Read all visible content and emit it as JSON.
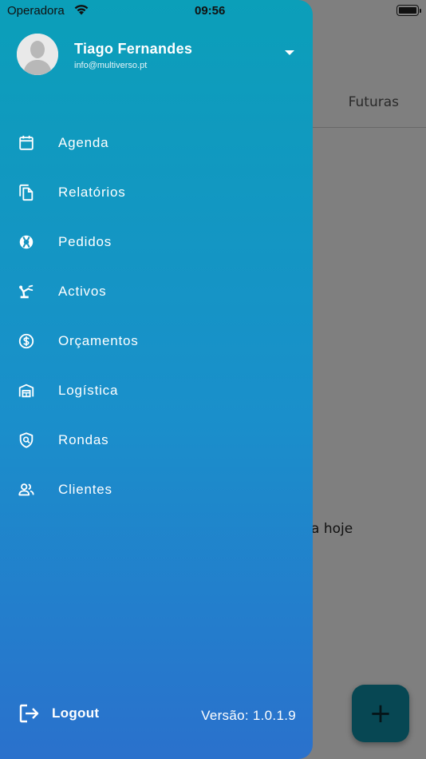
{
  "status_bar": {
    "carrier": "Operadora",
    "time": "09:56"
  },
  "background": {
    "tab_future": "Futuras",
    "empty_text": "a hoje",
    "fab_label": "+"
  },
  "drawer": {
    "user": {
      "name": "Tiago Fernandes",
      "email": "info@multiverso.pt"
    },
    "menu": [
      {
        "label": "Agenda",
        "icon": "calendar-icon"
      },
      {
        "label": "Relatórios",
        "icon": "documents-icon"
      },
      {
        "label": "Pedidos",
        "icon": "lifebuoy-icon"
      },
      {
        "label": "Activos",
        "icon": "robot-arm-icon"
      },
      {
        "label": "Orçamentos",
        "icon": "dollar-circle-icon"
      },
      {
        "label": "Logística",
        "icon": "warehouse-icon"
      },
      {
        "label": "Rondas",
        "icon": "shield-search-icon"
      },
      {
        "label": "Clientes",
        "icon": "people-icon"
      }
    ],
    "logout_label": "Logout",
    "version_label": "Versão: 1.0.1.9"
  },
  "colors": {
    "drawer_top": "#0b9fb9",
    "drawer_bottom": "#2a71cc",
    "fab": "#0e8fa6"
  }
}
